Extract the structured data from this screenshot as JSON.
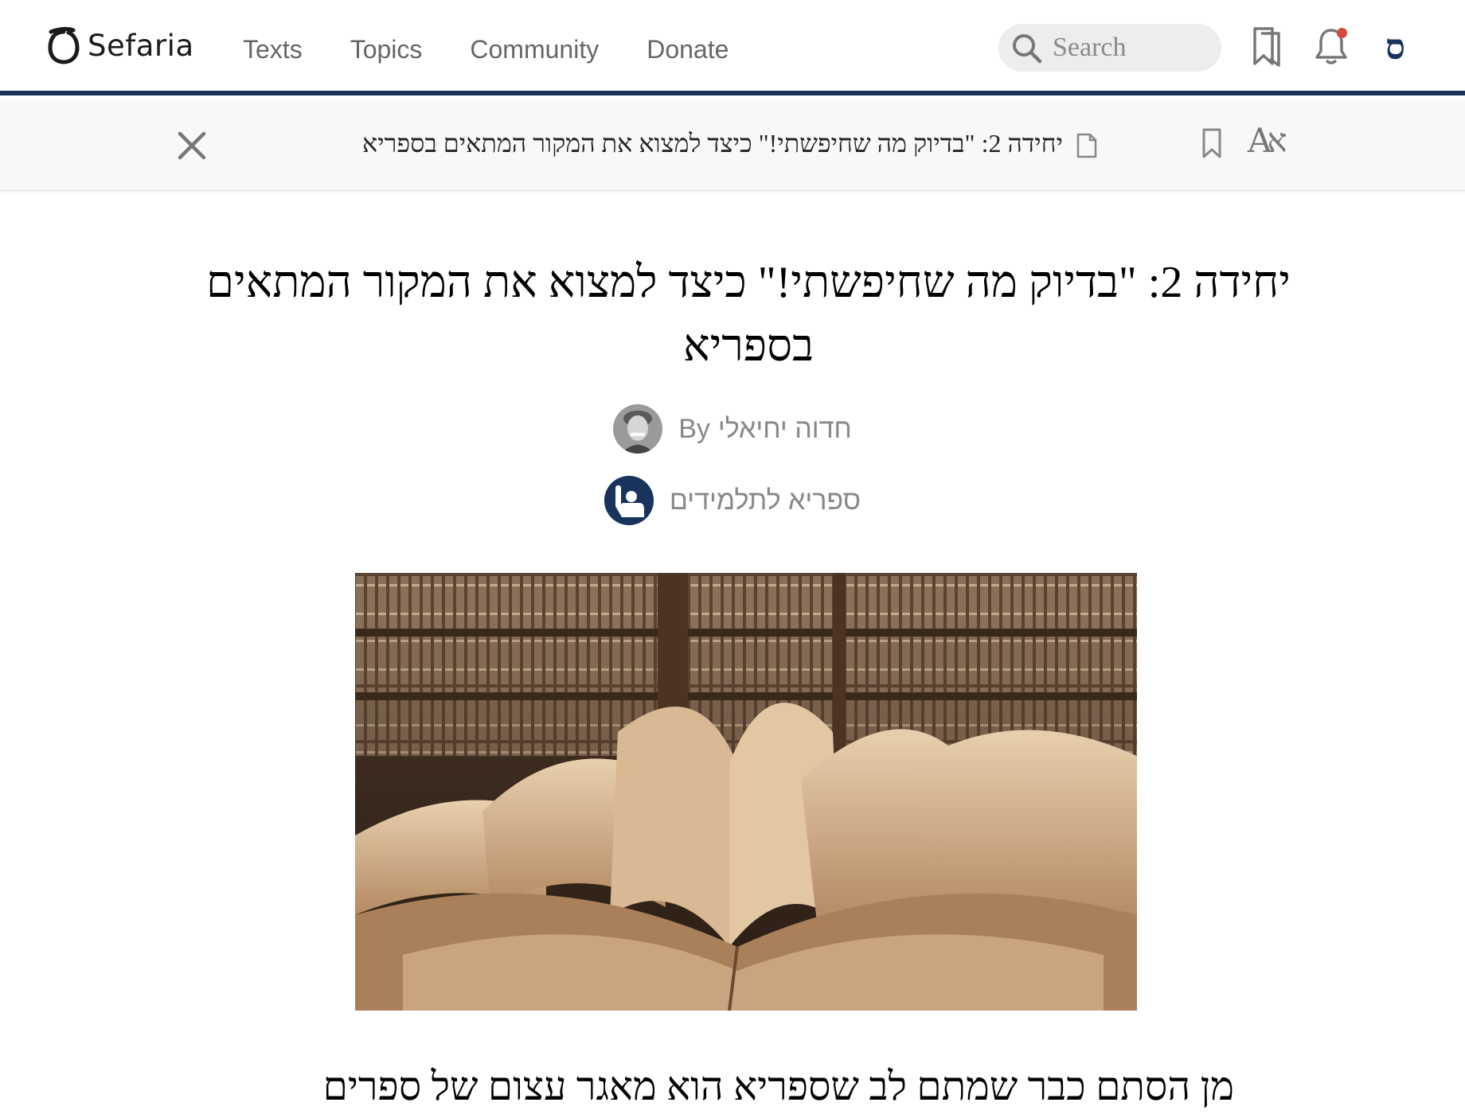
{
  "header": {
    "brand": "Sefaria",
    "nav": [
      "Texts",
      "Topics",
      "Community",
      "Donate"
    ],
    "search_placeholder": "Search",
    "language_glyph": "ס"
  },
  "toolbar": {
    "title": "יחידה 2: \"בדיוק מה שחיפשתי!\" כיצד למצוא את המקור המתאים בספריא",
    "font_toggle": "Aא"
  },
  "sheet": {
    "title": "יחידה 2: \"בדיוק מה שחיפשתי!\" כיצד למצוא את המקור המתאים בספריא",
    "by_label": "By",
    "author": "חדוה יחיאלי",
    "collection": "ספריא לתלמידים",
    "body_first_line": "מן הסתם כבר שמתם לב שספריא הוא מאגר עצום של ספרים"
  },
  "colors": {
    "brand_navy": "#18345d",
    "notification_dot": "#d24a3c"
  },
  "icons": {
    "logo": "sefaria-logo-icon",
    "search": "search-icon",
    "saved": "bookmarks-icon",
    "notifications": "bell-icon",
    "close": "close-icon",
    "sheet": "document-icon",
    "bookmark": "bookmark-icon"
  }
}
